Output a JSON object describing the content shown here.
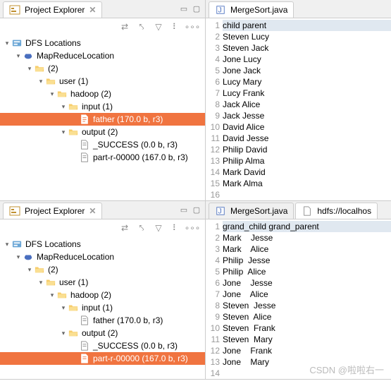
{
  "top": {
    "explorer_title": "Project Explorer",
    "tree": {
      "root": "DFS Locations",
      "loc": "MapReduceLocation",
      "n2": "(2)",
      "user": "user (1)",
      "hadoop": "hadoop (2)",
      "input": "input (1)",
      "father": "father (170.0 b, r3)",
      "output": "output (2)",
      "success": "_SUCCESS (0.0 b, r3)",
      "part": "part-r-00000 (167.0 b, r3)"
    },
    "editor_tab": "MergeSort.java",
    "lines": [
      "child parent",
      "Steven Lucy",
      "Steven Jack",
      "Jone Lucy",
      "Jone Jack",
      "Lucy Mary",
      "Lucy Frank",
      "Jack Alice",
      "Jack Jesse",
      "David Alice",
      "David Jesse",
      "Philip David",
      "Philip Alma",
      "Mark David",
      "Mark Alma",
      ""
    ]
  },
  "bottom": {
    "explorer_title": "Project Explorer",
    "tree": {
      "root": "DFS Locations",
      "loc": "MapReduceLocation",
      "n2": "(2)",
      "user": "user (1)",
      "hadoop": "hadoop (2)",
      "input": "input (1)",
      "father": "father (170.0 b, r3)",
      "output": "output (2)",
      "success": "_SUCCESS (0.0 b, r3)",
      "part": "part-r-00000 (167.0 b, r3)"
    },
    "editor_tab": "MergeSort.java",
    "editor_tab2": "hdfs://localhos",
    "lines": [
      "grand_child grand_parent",
      "Mark    Jesse",
      "Mark    Alice",
      "Philip  Jesse",
      "Philip  Alice",
      "Jone    Jesse",
      "Jone    Alice",
      "Steven  Jesse",
      "Steven  Alice",
      "Steven  Frank",
      "Steven  Mary",
      "Jone    Frank",
      "Jone    Mary",
      ""
    ]
  },
  "watermark": "CSDN @啦啦右一"
}
